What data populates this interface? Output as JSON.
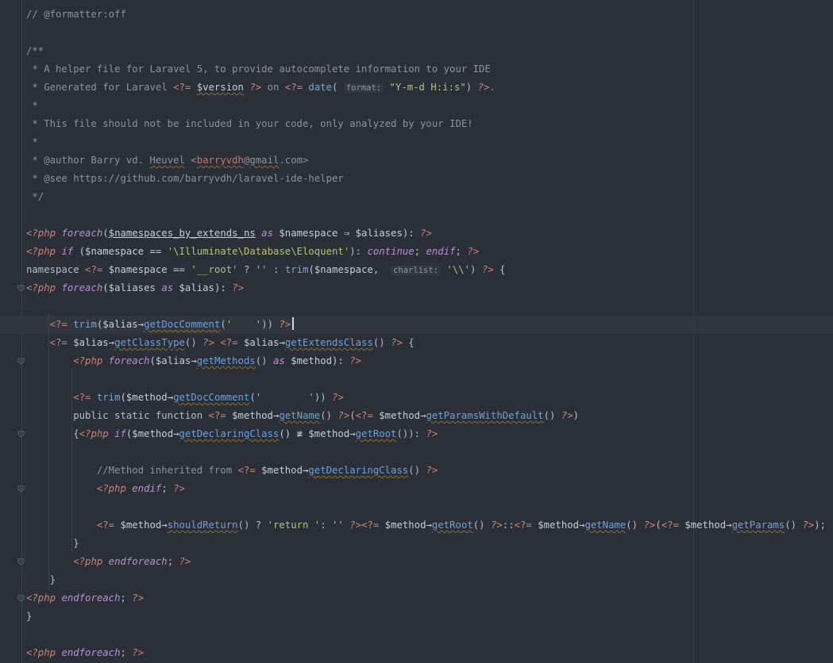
{
  "editor": {
    "lines": [
      [
        {
          "t": "// @formatter:off",
          "c": "c"
        }
      ],
      [],
      [
        {
          "t": "/**",
          "c": "c"
        }
      ],
      [
        {
          "t": " * A helper file for Laravel 5, to provide autocomplete information to your IDE",
          "c": "c"
        }
      ],
      [
        {
          "t": " * Generated for Laravel ",
          "c": "c"
        },
        {
          "t": "<?=",
          "c": "tag"
        },
        {
          "t": " ",
          "c": "t"
        },
        {
          "t": "$version",
          "c": "v sq"
        },
        {
          "t": " ?>",
          "c": "php"
        },
        {
          "t": " on ",
          "c": "c"
        },
        {
          "t": "<?=",
          "c": "tag"
        },
        {
          "t": " ",
          "c": "t"
        },
        {
          "t": "date",
          "c": "fn"
        },
        {
          "t": "( ",
          "c": "op"
        },
        {
          "t": "format:",
          "c": "hint"
        },
        {
          "t": " ",
          "c": "t"
        },
        {
          "t": "\"Y-m-d H:i:s\"",
          "c": "s"
        },
        {
          "t": ") ",
          "c": "op"
        },
        {
          "t": "?>",
          "c": "php"
        },
        {
          "t": ".",
          "c": "c"
        }
      ],
      [
        {
          "t": " *",
          "c": "c"
        }
      ],
      [
        {
          "t": " * This file should not be included in your code, only analyzed by your IDE!",
          "c": "c"
        }
      ],
      [
        {
          "t": " *",
          "c": "c"
        }
      ],
      [
        {
          "t": " * @author Barry vd. ",
          "c": "c"
        },
        {
          "t": "Heuvel",
          "c": "c sq"
        },
        {
          "t": " <",
          "c": "c"
        },
        {
          "t": "barryvdh",
          "c": "red"
        },
        {
          "t": "@",
          "c": "c"
        },
        {
          "t": "gmail",
          "c": "c sq"
        },
        {
          "t": ".com>",
          "c": "c"
        }
      ],
      [
        {
          "t": " * @see https://github.com/barryvdh/laravel-ide-helper",
          "c": "c"
        }
      ],
      [
        {
          "t": " */",
          "c": "c"
        }
      ],
      [],
      [
        {
          "t": "<?php",
          "c": "php"
        },
        {
          "t": " ",
          "c": "t"
        },
        {
          "t": "foreach",
          "c": "kw"
        },
        {
          "t": "(",
          "c": "op"
        },
        {
          "t": "$namespaces_by_extends_ns",
          "c": "v ul"
        },
        {
          "t": " ",
          "c": "t"
        },
        {
          "t": "as",
          "c": "kw"
        },
        {
          "t": " $namespace ⇒ $aliases): ",
          "c": "v"
        },
        {
          "t": "?>",
          "c": "php"
        }
      ],
      [
        {
          "t": "<?php",
          "c": "php"
        },
        {
          "t": " ",
          "c": "t"
        },
        {
          "t": "if",
          "c": "kw"
        },
        {
          "t": " ($namespace == ",
          "c": "v"
        },
        {
          "t": "'\\Illuminate\\Database\\Eloquent'",
          "c": "s"
        },
        {
          "t": "): ",
          "c": "op"
        },
        {
          "t": "continue",
          "c": "kw"
        },
        {
          "t": "; ",
          "c": "op"
        },
        {
          "t": "endif",
          "c": "kw"
        },
        {
          "t": "; ",
          "c": "op"
        },
        {
          "t": "?>",
          "c": "php"
        }
      ],
      [
        {
          "t": "namespace ",
          "c": "t"
        },
        {
          "t": "<?=",
          "c": "tag"
        },
        {
          "t": " $namespace == ",
          "c": "v"
        },
        {
          "t": "'__root'",
          "c": "s"
        },
        {
          "t": " ? ",
          "c": "op"
        },
        {
          "t": "''",
          "c": "s"
        },
        {
          "t": " : ",
          "c": "op"
        },
        {
          "t": "trim",
          "c": "fn"
        },
        {
          "t": "($namespace,  ",
          "c": "v"
        },
        {
          "t": "charlist:",
          "c": "hint"
        },
        {
          "t": " ",
          "c": "t"
        },
        {
          "t": "'\\\\'",
          "c": "s"
        },
        {
          "t": ") ",
          "c": "op"
        },
        {
          "t": "?>",
          "c": "php"
        },
        {
          "t": " {",
          "c": "op"
        }
      ],
      [
        {
          "t": "<?php",
          "c": "php"
        },
        {
          "t": " ",
          "c": "t"
        },
        {
          "t": "foreach",
          "c": "kw"
        },
        {
          "t": "($aliases ",
          "c": "v"
        },
        {
          "t": "as",
          "c": "kw"
        },
        {
          "t": " $alias): ",
          "c": "v"
        },
        {
          "t": "?>",
          "c": "php"
        }
      ],
      [],
      [
        {
          "t": "    ",
          "c": "t"
        },
        {
          "t": "<?=",
          "c": "tag"
        },
        {
          "t": " ",
          "c": "t"
        },
        {
          "t": "trim",
          "c": "fn"
        },
        {
          "t": "($alias→",
          "c": "v"
        },
        {
          "t": "getDocComment",
          "c": "m"
        },
        {
          "t": "(",
          "c": "op"
        },
        {
          "t": "'    '",
          "c": "s"
        },
        {
          "t": ")) ",
          "c": "op"
        },
        {
          "t": "?>",
          "c": "php"
        },
        {
          "t": "",
          "c": "caret"
        }
      ],
      [
        {
          "t": "    ",
          "c": "t"
        },
        {
          "t": "<?=",
          "c": "tag"
        },
        {
          "t": " $alias→",
          "c": "v"
        },
        {
          "t": "getClassType",
          "c": "m"
        },
        {
          "t": "() ",
          "c": "op"
        },
        {
          "t": "?>",
          "c": "php"
        },
        {
          "t": " ",
          "c": "t"
        },
        {
          "t": "<?=",
          "c": "tag"
        },
        {
          "t": " $alias→",
          "c": "v"
        },
        {
          "t": "getExtendsClass",
          "c": "m"
        },
        {
          "t": "() ",
          "c": "op"
        },
        {
          "t": "?>",
          "c": "php"
        },
        {
          "t": " {",
          "c": "op"
        }
      ],
      [
        {
          "t": "        ",
          "c": "t"
        },
        {
          "t": "<?php",
          "c": "php"
        },
        {
          "t": " ",
          "c": "t"
        },
        {
          "t": "foreach",
          "c": "kw"
        },
        {
          "t": "($alias→",
          "c": "v"
        },
        {
          "t": "getMethods",
          "c": "m"
        },
        {
          "t": "() ",
          "c": "op"
        },
        {
          "t": "as",
          "c": "kw"
        },
        {
          "t": " $method): ",
          "c": "v"
        },
        {
          "t": "?>",
          "c": "php"
        }
      ],
      [],
      [
        {
          "t": "        ",
          "c": "t"
        },
        {
          "t": "<?=",
          "c": "tag"
        },
        {
          "t": " ",
          "c": "t"
        },
        {
          "t": "trim",
          "c": "fn"
        },
        {
          "t": "($method→",
          "c": "v"
        },
        {
          "t": "getDocComment",
          "c": "m"
        },
        {
          "t": "(",
          "c": "op"
        },
        {
          "t": "'        '",
          "c": "s"
        },
        {
          "t": ")) ",
          "c": "op"
        },
        {
          "t": "?>",
          "c": "php"
        }
      ],
      [
        {
          "t": "        public static function ",
          "c": "t"
        },
        {
          "t": "<?=",
          "c": "tag"
        },
        {
          "t": " $method→",
          "c": "v"
        },
        {
          "t": "getName",
          "c": "m"
        },
        {
          "t": "() ",
          "c": "op"
        },
        {
          "t": "?>",
          "c": "php"
        },
        {
          "t": "(",
          "c": "op"
        },
        {
          "t": "<?=",
          "c": "tag"
        },
        {
          "t": " $method→",
          "c": "v"
        },
        {
          "t": "getParamsWithDefault",
          "c": "m"
        },
        {
          "t": "() ",
          "c": "op"
        },
        {
          "t": "?>",
          "c": "php"
        },
        {
          "t": ")",
          "c": "op"
        }
      ],
      [
        {
          "t": "        {",
          "c": "op"
        },
        {
          "t": "<?php",
          "c": "php"
        },
        {
          "t": " ",
          "c": "t"
        },
        {
          "t": "if",
          "c": "kw"
        },
        {
          "t": "($method→",
          "c": "v"
        },
        {
          "t": "getDeclaringClass",
          "c": "m"
        },
        {
          "t": "() ≢ $method→",
          "c": "v"
        },
        {
          "t": "getRoot",
          "c": "m"
        },
        {
          "t": "()): ",
          "c": "op"
        },
        {
          "t": "?>",
          "c": "php"
        }
      ],
      [],
      [
        {
          "t": "            //Method inherited from ",
          "c": "c"
        },
        {
          "t": "<?=",
          "c": "tag"
        },
        {
          "t": " $method→",
          "c": "v"
        },
        {
          "t": "getDeclaringClass",
          "c": "m"
        },
        {
          "t": "() ",
          "c": "op"
        },
        {
          "t": "?>",
          "c": "php"
        }
      ],
      [
        {
          "t": "            ",
          "c": "t"
        },
        {
          "t": "<?php",
          "c": "php"
        },
        {
          "t": " ",
          "c": "t"
        },
        {
          "t": "endif",
          "c": "kw"
        },
        {
          "t": "; ",
          "c": "op"
        },
        {
          "t": "?>",
          "c": "php"
        }
      ],
      [],
      [
        {
          "t": "            ",
          "c": "t"
        },
        {
          "t": "<?=",
          "c": "tag"
        },
        {
          "t": " $method→",
          "c": "v"
        },
        {
          "t": "shouldReturn",
          "c": "m"
        },
        {
          "t": "() ? ",
          "c": "op"
        },
        {
          "t": "'return '",
          "c": "s"
        },
        {
          "t": ": ",
          "c": "op"
        },
        {
          "t": "''",
          "c": "s"
        },
        {
          "t": " ",
          "c": "t"
        },
        {
          "t": "?>",
          "c": "php"
        },
        {
          "t": "<?=",
          "c": "tag"
        },
        {
          "t": " $method→",
          "c": "v"
        },
        {
          "t": "getRoot",
          "c": "m"
        },
        {
          "t": "() ",
          "c": "op"
        },
        {
          "t": "?>",
          "c": "php"
        },
        {
          "t": "::",
          "c": "op"
        },
        {
          "t": "<?=",
          "c": "tag"
        },
        {
          "t": " $method→",
          "c": "v"
        },
        {
          "t": "getName",
          "c": "m"
        },
        {
          "t": "() ",
          "c": "op"
        },
        {
          "t": "?>",
          "c": "php"
        },
        {
          "t": "(",
          "c": "op"
        },
        {
          "t": "<?=",
          "c": "tag"
        },
        {
          "t": " $method→",
          "c": "v"
        },
        {
          "t": "getParams",
          "c": "m"
        },
        {
          "t": "() ",
          "c": "op"
        },
        {
          "t": "?>",
          "c": "php"
        },
        {
          "t": ");",
          "c": "op"
        }
      ],
      [
        {
          "t": "        }",
          "c": "op"
        }
      ],
      [
        {
          "t": "        ",
          "c": "t"
        },
        {
          "t": "<?php",
          "c": "php"
        },
        {
          "t": " ",
          "c": "t"
        },
        {
          "t": "endforeach",
          "c": "kw"
        },
        {
          "t": "; ",
          "c": "op"
        },
        {
          "t": "?>",
          "c": "php"
        }
      ],
      [
        {
          "t": "    }",
          "c": "op"
        }
      ],
      [
        {
          "t": "<?php",
          "c": "php"
        },
        {
          "t": " ",
          "c": "t"
        },
        {
          "t": "endforeach",
          "c": "kw"
        },
        {
          "t": "; ",
          "c": "op"
        },
        {
          "t": "?>",
          "c": "php"
        }
      ],
      [
        {
          "t": "}",
          "c": "op"
        }
      ],
      [],
      [
        {
          "t": "<?php",
          "c": "php"
        },
        {
          "t": " ",
          "c": "t"
        },
        {
          "t": "endforeach",
          "c": "kw"
        },
        {
          "t": "; ",
          "c": "op"
        },
        {
          "t": "?>",
          "c": "php"
        }
      ]
    ],
    "fold_markers": [
      15,
      19,
      23,
      26,
      30,
      32
    ]
  }
}
